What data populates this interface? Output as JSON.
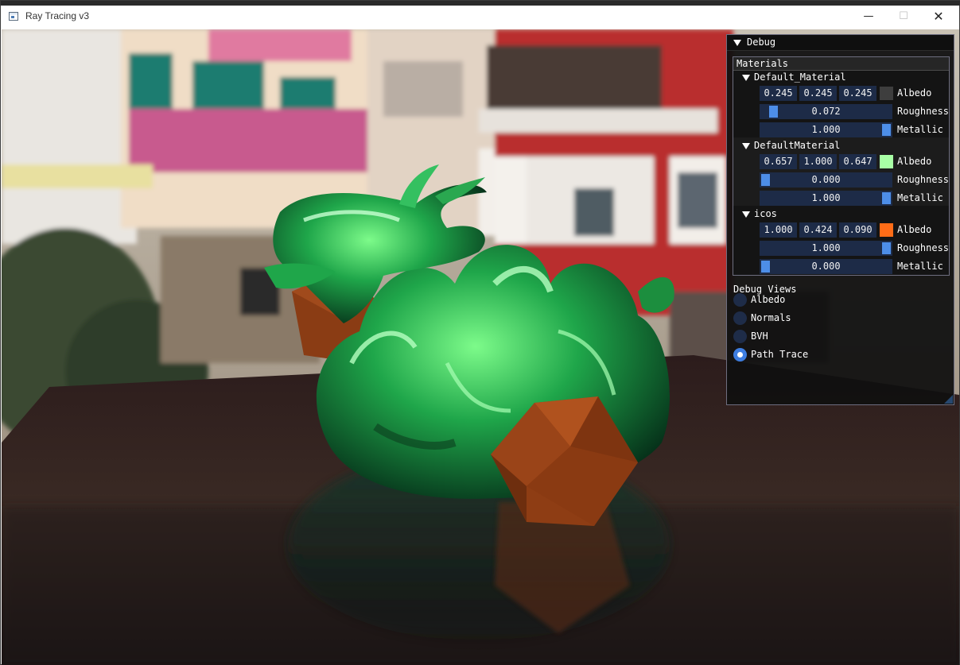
{
  "window": {
    "title": "Ray Tracing v3",
    "minimize_glyph": "—",
    "maximize_glyph": "☐",
    "close_glyph": "✕",
    "icon": "app-window-icon"
  },
  "debug": {
    "title": "Debug",
    "materials_header": "Materials",
    "materials": [
      {
        "name": "Default_Material",
        "albedo": [
          "0.245",
          "0.245",
          "0.245"
        ],
        "albedo_color": "#3e3e3e",
        "roughness": "0.072",
        "roughness_fraction": 0.072,
        "metallic": "1.000",
        "metallic_fraction": 1.0
      },
      {
        "name": "DefaultMaterial",
        "albedo": [
          "0.657",
          "1.000",
          "0.647"
        ],
        "albedo_color": "#a8ffa5",
        "roughness": "0.000",
        "roughness_fraction": 0.0,
        "metallic": "1.000",
        "metallic_fraction": 1.0
      },
      {
        "name": "icos",
        "albedo": [
          "1.000",
          "0.424",
          "0.090"
        ],
        "albedo_color": "#ff6c17",
        "roughness": "1.000",
        "roughness_fraction": 1.0,
        "metallic": "0.000",
        "metallic_fraction": 0.0
      }
    ],
    "labels": {
      "albedo": "Albedo",
      "roughness": "Roughness",
      "metallic": "Metallic"
    },
    "views_header": "Debug Views",
    "views": [
      {
        "label": "Albedo",
        "selected": false
      },
      {
        "label": "Normals",
        "selected": false
      },
      {
        "label": "BVH",
        "selected": false
      },
      {
        "label": "Path Trace",
        "selected": true
      }
    ]
  },
  "colors": {
    "accent": "#3d7de0",
    "frame_bg": "#1d2b47",
    "border": "#6e6e80"
  }
}
